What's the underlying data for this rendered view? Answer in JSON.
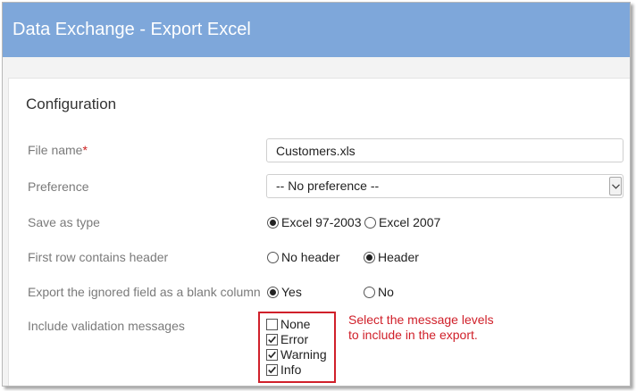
{
  "window": {
    "title": "Data Exchange - Export Excel"
  },
  "config": {
    "section_title": "Configuration",
    "file_name": {
      "label": "File name",
      "required_mark": "*",
      "value": "Customers.xls"
    },
    "preference": {
      "label": "Preference",
      "selected": "-- No preference --"
    },
    "save_as_type": {
      "label": "Save as type",
      "options": [
        {
          "label": "Excel 97-2003",
          "selected": true
        },
        {
          "label": "Excel 2007",
          "selected": false
        }
      ]
    },
    "first_row_header": {
      "label": "First row contains header",
      "options": [
        {
          "label": "No header",
          "selected": false
        },
        {
          "label": "Header",
          "selected": true
        }
      ]
    },
    "ignored_field_blank": {
      "label": "Export the ignored field as a blank column",
      "options": [
        {
          "label": "Yes",
          "selected": true
        },
        {
          "label": "No",
          "selected": false
        }
      ]
    },
    "validation_messages": {
      "label": "Include validation messages",
      "options": [
        {
          "label": "None",
          "checked": false
        },
        {
          "label": "Error",
          "checked": true
        },
        {
          "label": "Warning",
          "checked": true
        },
        {
          "label": "Info",
          "checked": true
        }
      ],
      "annotation_line1": "Select the message levels",
      "annotation_line2": "to include in the export."
    }
  },
  "colors": {
    "titlebar": "#7ea7da",
    "annotation": "#d0202a"
  }
}
